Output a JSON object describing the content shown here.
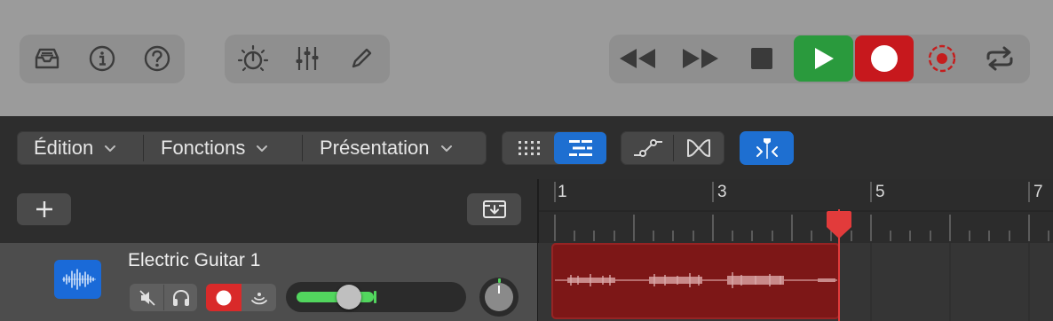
{
  "menus": {
    "edit": "Édition",
    "functions": "Fonctions",
    "view": "Présentation"
  },
  "ruler": {
    "bars": [
      "1",
      "3",
      "5",
      "7"
    ]
  },
  "track": {
    "name": "Electric Guitar 1",
    "volume_level": 0.24,
    "color": "#1a6ad8"
  },
  "colors": {
    "play": "#2a9a3d",
    "record": "#c7181d",
    "region": "#7d1717",
    "playhead": "#e23b3b",
    "accent": "#1e6fd1"
  },
  "icons": {
    "library": "inbox-tray-icon",
    "inspector": "info-icon",
    "help": "question-icon",
    "smart_controls": "brightness-dial-icon",
    "mixer": "sliders-icon",
    "editors": "pencil-icon"
  }
}
